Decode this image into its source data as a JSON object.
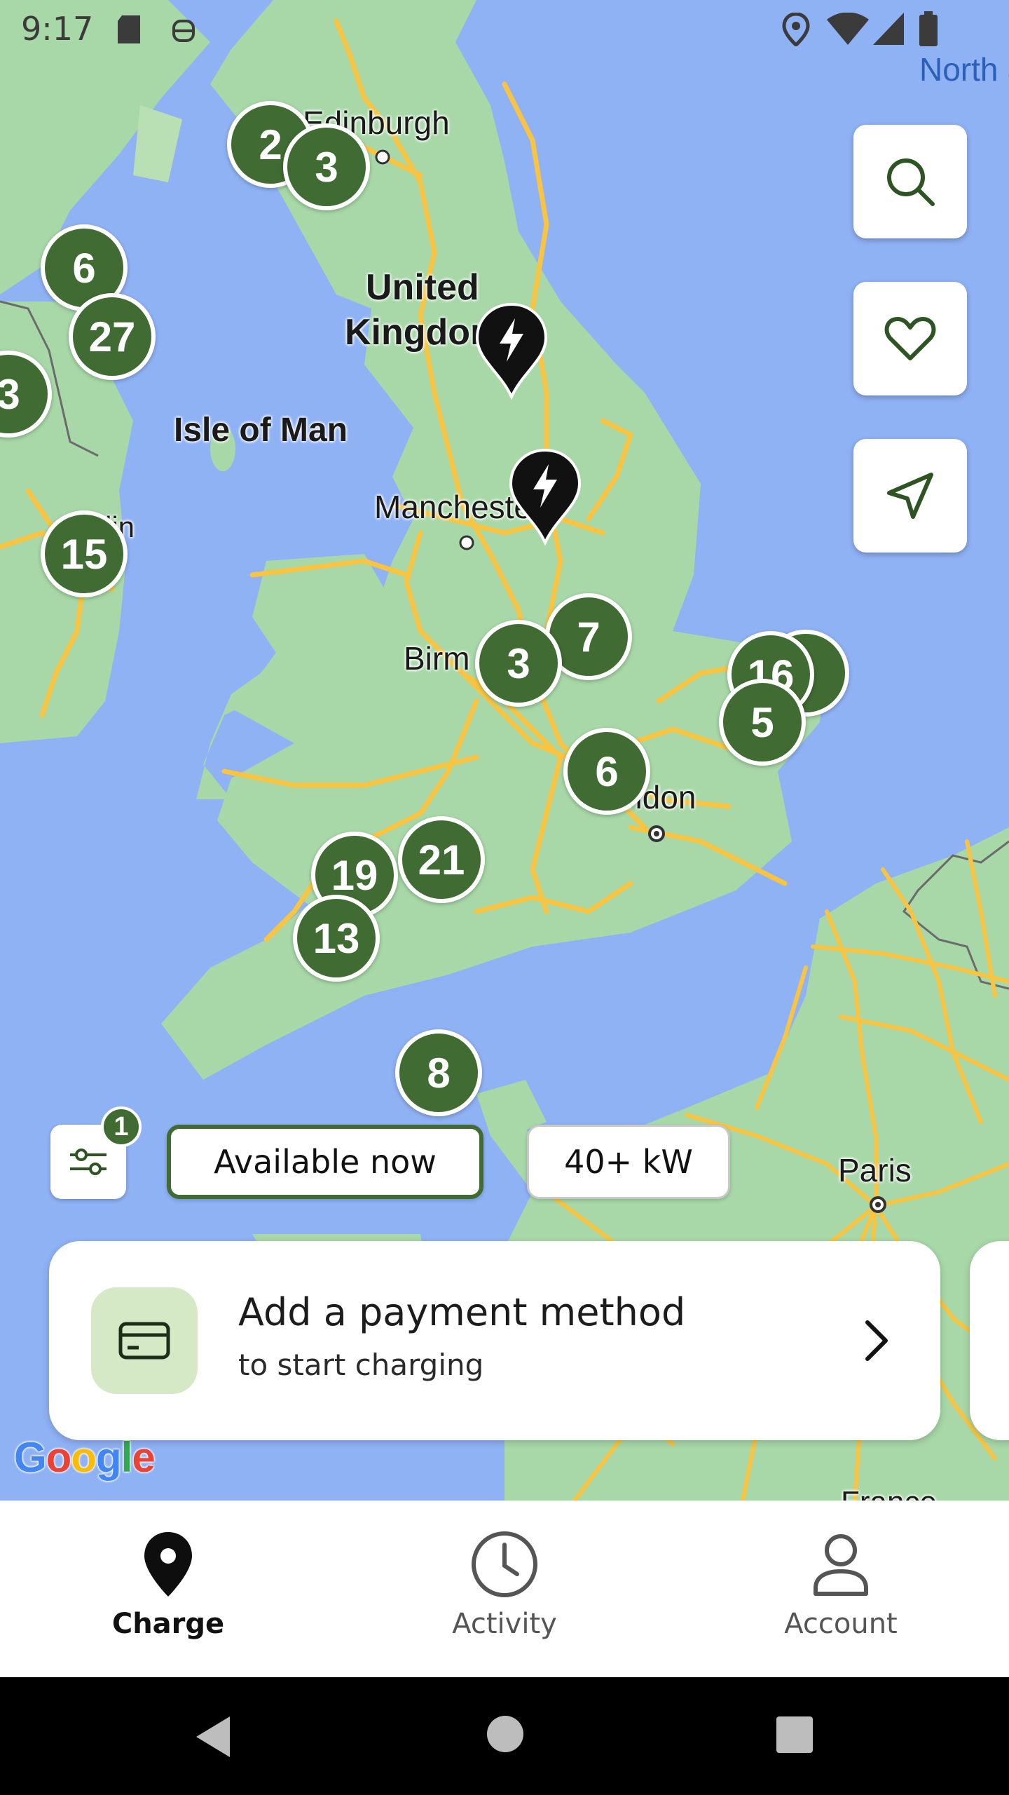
{
  "status_bar": {
    "time": "9:17"
  },
  "map": {
    "labels": {
      "edinburgh": "Edinburgh",
      "uk_line1": "United",
      "uk_line2": "Kingdom",
      "isle_of_man": "Isle of Man",
      "manchester": "Manchester",
      "birmingham": "Birm",
      "london": "London",
      "dublin": "lin",
      "paris": "Paris",
      "north_sea": "North S",
      "france": "France"
    },
    "clusters": [
      "2",
      "3",
      "6",
      "27",
      "3",
      "15",
      "7",
      "3",
      "16",
      "5",
      "6",
      "19",
      "21",
      "13",
      "8"
    ],
    "icons": {
      "station_pin": "charging-station-pin-icon"
    },
    "attribution": "Google"
  },
  "side_buttons": {
    "search": "search-icon",
    "favorites": "heart-icon",
    "locate": "navigation-arrow-icon"
  },
  "filters": {
    "badge_count": "1",
    "chips": [
      {
        "label": "Available now",
        "active": true
      },
      {
        "label": "40+ kW",
        "active": false
      }
    ]
  },
  "payment_card": {
    "title": "Add a payment method",
    "subtitle": "to start charging",
    "icon": "credit-card-icon"
  },
  "tabs": [
    {
      "label": "Charge",
      "icon": "location-pin-icon",
      "active": true
    },
    {
      "label": "Activity",
      "icon": "clock-icon",
      "active": false
    },
    {
      "label": "Account",
      "icon": "person-icon",
      "active": false
    }
  ],
  "colors": {
    "accent": "#406b32",
    "map_water": "#8fb2f5",
    "map_land": "#a8d8a8",
    "road": "#f8c441"
  }
}
